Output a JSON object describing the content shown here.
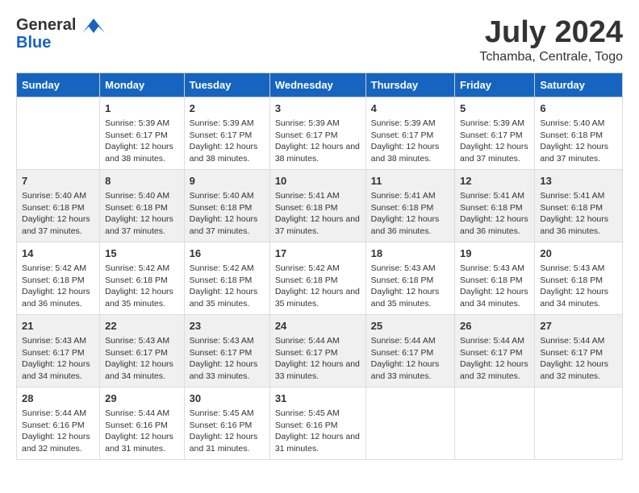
{
  "header": {
    "logo_line1": "General",
    "logo_line2": "Blue",
    "month_year": "July 2024",
    "location": "Tchamba, Centrale, Togo"
  },
  "weekdays": [
    "Sunday",
    "Monday",
    "Tuesday",
    "Wednesday",
    "Thursday",
    "Friday",
    "Saturday"
  ],
  "weeks": [
    [
      {
        "day": "",
        "sunrise": "",
        "sunset": "",
        "daylight": ""
      },
      {
        "day": "1",
        "sunrise": "Sunrise: 5:39 AM",
        "sunset": "Sunset: 6:17 PM",
        "daylight": "Daylight: 12 hours and 38 minutes."
      },
      {
        "day": "2",
        "sunrise": "Sunrise: 5:39 AM",
        "sunset": "Sunset: 6:17 PM",
        "daylight": "Daylight: 12 hours and 38 minutes."
      },
      {
        "day": "3",
        "sunrise": "Sunrise: 5:39 AM",
        "sunset": "Sunset: 6:17 PM",
        "daylight": "Daylight: 12 hours and 38 minutes."
      },
      {
        "day": "4",
        "sunrise": "Sunrise: 5:39 AM",
        "sunset": "Sunset: 6:17 PM",
        "daylight": "Daylight: 12 hours and 38 minutes."
      },
      {
        "day": "5",
        "sunrise": "Sunrise: 5:39 AM",
        "sunset": "Sunset: 6:17 PM",
        "daylight": "Daylight: 12 hours and 37 minutes."
      },
      {
        "day": "6",
        "sunrise": "Sunrise: 5:40 AM",
        "sunset": "Sunset: 6:18 PM",
        "daylight": "Daylight: 12 hours and 37 minutes."
      }
    ],
    [
      {
        "day": "7",
        "sunrise": "Sunrise: 5:40 AM",
        "sunset": "Sunset: 6:18 PM",
        "daylight": "Daylight: 12 hours and 37 minutes."
      },
      {
        "day": "8",
        "sunrise": "Sunrise: 5:40 AM",
        "sunset": "Sunset: 6:18 PM",
        "daylight": "Daylight: 12 hours and 37 minutes."
      },
      {
        "day": "9",
        "sunrise": "Sunrise: 5:40 AM",
        "sunset": "Sunset: 6:18 PM",
        "daylight": "Daylight: 12 hours and 37 minutes."
      },
      {
        "day": "10",
        "sunrise": "Sunrise: 5:41 AM",
        "sunset": "Sunset: 6:18 PM",
        "daylight": "Daylight: 12 hours and 37 minutes."
      },
      {
        "day": "11",
        "sunrise": "Sunrise: 5:41 AM",
        "sunset": "Sunset: 6:18 PM",
        "daylight": "Daylight: 12 hours and 36 minutes."
      },
      {
        "day": "12",
        "sunrise": "Sunrise: 5:41 AM",
        "sunset": "Sunset: 6:18 PM",
        "daylight": "Daylight: 12 hours and 36 minutes."
      },
      {
        "day": "13",
        "sunrise": "Sunrise: 5:41 AM",
        "sunset": "Sunset: 6:18 PM",
        "daylight": "Daylight: 12 hours and 36 minutes."
      }
    ],
    [
      {
        "day": "14",
        "sunrise": "Sunrise: 5:42 AM",
        "sunset": "Sunset: 6:18 PM",
        "daylight": "Daylight: 12 hours and 36 minutes."
      },
      {
        "day": "15",
        "sunrise": "Sunrise: 5:42 AM",
        "sunset": "Sunset: 6:18 PM",
        "daylight": "Daylight: 12 hours and 35 minutes."
      },
      {
        "day": "16",
        "sunrise": "Sunrise: 5:42 AM",
        "sunset": "Sunset: 6:18 PM",
        "daylight": "Daylight: 12 hours and 35 minutes."
      },
      {
        "day": "17",
        "sunrise": "Sunrise: 5:42 AM",
        "sunset": "Sunset: 6:18 PM",
        "daylight": "Daylight: 12 hours and 35 minutes."
      },
      {
        "day": "18",
        "sunrise": "Sunrise: 5:43 AM",
        "sunset": "Sunset: 6:18 PM",
        "daylight": "Daylight: 12 hours and 35 minutes."
      },
      {
        "day": "19",
        "sunrise": "Sunrise: 5:43 AM",
        "sunset": "Sunset: 6:18 PM",
        "daylight": "Daylight: 12 hours and 34 minutes."
      },
      {
        "day": "20",
        "sunrise": "Sunrise: 5:43 AM",
        "sunset": "Sunset: 6:18 PM",
        "daylight": "Daylight: 12 hours and 34 minutes."
      }
    ],
    [
      {
        "day": "21",
        "sunrise": "Sunrise: 5:43 AM",
        "sunset": "Sunset: 6:17 PM",
        "daylight": "Daylight: 12 hours and 34 minutes."
      },
      {
        "day": "22",
        "sunrise": "Sunrise: 5:43 AM",
        "sunset": "Sunset: 6:17 PM",
        "daylight": "Daylight: 12 hours and 34 minutes."
      },
      {
        "day": "23",
        "sunrise": "Sunrise: 5:43 AM",
        "sunset": "Sunset: 6:17 PM",
        "daylight": "Daylight: 12 hours and 33 minutes."
      },
      {
        "day": "24",
        "sunrise": "Sunrise: 5:44 AM",
        "sunset": "Sunset: 6:17 PM",
        "daylight": "Daylight: 12 hours and 33 minutes."
      },
      {
        "day": "25",
        "sunrise": "Sunrise: 5:44 AM",
        "sunset": "Sunset: 6:17 PM",
        "daylight": "Daylight: 12 hours and 33 minutes."
      },
      {
        "day": "26",
        "sunrise": "Sunrise: 5:44 AM",
        "sunset": "Sunset: 6:17 PM",
        "daylight": "Daylight: 12 hours and 32 minutes."
      },
      {
        "day": "27",
        "sunrise": "Sunrise: 5:44 AM",
        "sunset": "Sunset: 6:17 PM",
        "daylight": "Daylight: 12 hours and 32 minutes."
      }
    ],
    [
      {
        "day": "28",
        "sunrise": "Sunrise: 5:44 AM",
        "sunset": "Sunset: 6:16 PM",
        "daylight": "Daylight: 12 hours and 32 minutes."
      },
      {
        "day": "29",
        "sunrise": "Sunrise: 5:44 AM",
        "sunset": "Sunset: 6:16 PM",
        "daylight": "Daylight: 12 hours and 31 minutes."
      },
      {
        "day": "30",
        "sunrise": "Sunrise: 5:45 AM",
        "sunset": "Sunset: 6:16 PM",
        "daylight": "Daylight: 12 hours and 31 minutes."
      },
      {
        "day": "31",
        "sunrise": "Sunrise: 5:45 AM",
        "sunset": "Sunset: 6:16 PM",
        "daylight": "Daylight: 12 hours and 31 minutes."
      },
      {
        "day": "",
        "sunrise": "",
        "sunset": "",
        "daylight": ""
      },
      {
        "day": "",
        "sunrise": "",
        "sunset": "",
        "daylight": ""
      },
      {
        "day": "",
        "sunrise": "",
        "sunset": "",
        "daylight": ""
      }
    ]
  ]
}
